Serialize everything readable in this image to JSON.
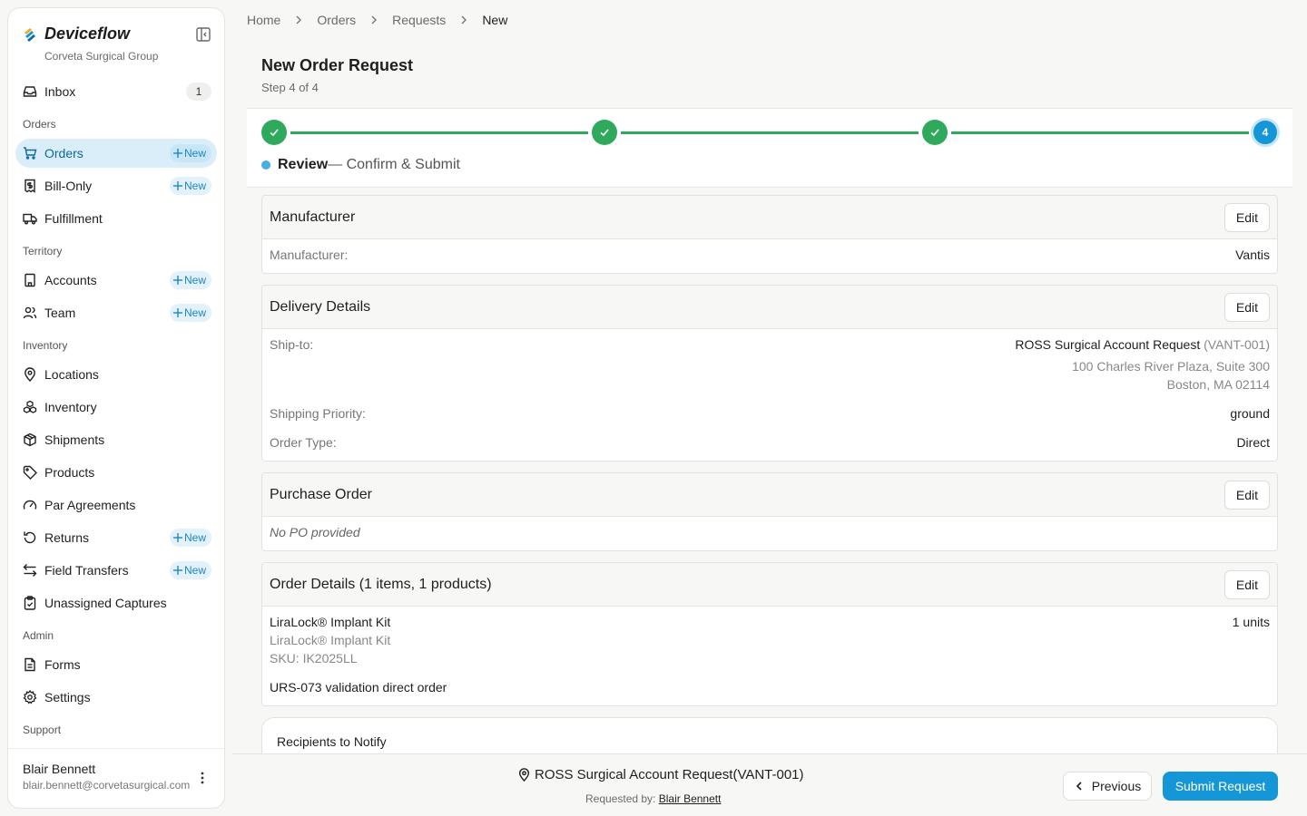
{
  "sidebar": {
    "brand": "Deviceflow",
    "org": "Corveta Surgical Group",
    "inbox": {
      "label": "Inbox",
      "count": "1"
    },
    "sections": {
      "orders": "Orders",
      "territory": "Territory",
      "inventory": "Inventory",
      "admin": "Admin",
      "support": "Support"
    },
    "items": {
      "orders": "Orders",
      "bill_only": "Bill-Only",
      "fulfillment": "Fulfillment",
      "accounts": "Accounts",
      "team": "Team",
      "locations": "Locations",
      "inventory": "Inventory",
      "shipments": "Shipments",
      "products": "Products",
      "par_agreements": "Par Agreements",
      "returns": "Returns",
      "field_transfers": "Field Transfers",
      "unassigned_captures": "Unassigned Captures",
      "forms": "Forms",
      "settings": "Settings"
    },
    "new_label": "New",
    "user": {
      "name": "Blair Bennett",
      "email": "blair.bennett@corvetasurgical.com"
    }
  },
  "breadcrumb": [
    "Home",
    "Orders",
    "Requests",
    "New"
  ],
  "page": {
    "title": "New Order Request",
    "step": "Step 4 of 4"
  },
  "stepper": {
    "current_number": "4",
    "label_bold": "Review",
    "label_rest": "— Confirm & Submit"
  },
  "cards": {
    "edit_label": "Edit",
    "manufacturer": {
      "title": "Manufacturer",
      "key": "Manufacturer:",
      "value": "Vantis"
    },
    "delivery": {
      "title": "Delivery Details",
      "ship_to_key": "Ship-to:",
      "ship_to_name": "ROSS Surgical Account Request",
      "ship_to_code": "(VANT-001)",
      "address_line1": "100 Charles River Plaza, Suite 300",
      "address_line2": "Boston, MA 02114",
      "priority_key": "Shipping Priority:",
      "priority_value": "ground",
      "type_key": "Order Type:",
      "type_value": "Direct"
    },
    "purchase_order": {
      "title": "Purchase Order",
      "empty": "No PO provided"
    },
    "order_details": {
      "title": "Order Details (1 items, 1 products)",
      "product_name": "LiraLock® Implant Kit",
      "product_desc": "LiraLock® Implant Kit",
      "sku": "SKU: IK2025LL",
      "quantity": "1 units",
      "note": "URS-073 validation direct order"
    },
    "recipients": {
      "title": "Recipients to Notify"
    }
  },
  "footer": {
    "account": "ROSS Surgical Account Request(VANT-001)",
    "requested_by_label": "Requested by:",
    "requested_by": "Blair Bennett",
    "previous": "Previous",
    "submit": "Submit Request"
  },
  "colors": {
    "accent": "#1596d6",
    "success": "#2fa95c",
    "active_nav_bg": "#d9eef9"
  }
}
